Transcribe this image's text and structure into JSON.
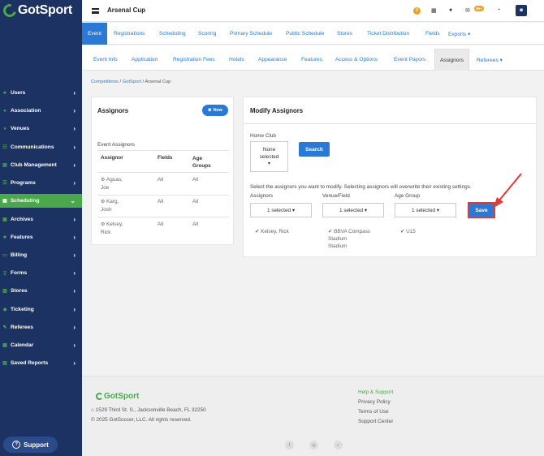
{
  "brand": {
    "name": "GotSport",
    "green": "#4aa84a",
    "navy": "#1c3263",
    "blue": "#2a7ad5",
    "highlight_red": "#e53935"
  },
  "topbar": {
    "title": "Arsenal Cup",
    "notification_count": "99+",
    "icons": [
      "menu-icon",
      "help-icon",
      "grid-icon",
      "user-icon",
      "mail-icon",
      "chat-icon",
      "account-icon"
    ]
  },
  "sidebar": {
    "items": [
      {
        "label": "Users",
        "icon": "users-icon"
      },
      {
        "label": "Association",
        "icon": "association-icon"
      },
      {
        "label": "Venues",
        "icon": "venues-icon"
      },
      {
        "label": "Communications",
        "icon": "communications-icon"
      },
      {
        "label": "Club Management",
        "icon": "club-icon"
      },
      {
        "label": "Programs",
        "icon": "programs-icon"
      },
      {
        "label": "Scheduling",
        "icon": "scheduling-icon",
        "active": true
      },
      {
        "label": "Archives",
        "icon": "archives-icon"
      },
      {
        "label": "Features",
        "icon": "features-icon"
      },
      {
        "label": "Billing",
        "icon": "billing-icon"
      },
      {
        "label": "Forms",
        "icon": "forms-icon"
      },
      {
        "label": "Stores",
        "icon": "stores-icon"
      },
      {
        "label": "Ticketing",
        "icon": "ticketing-icon"
      },
      {
        "label": "Referees",
        "icon": "referees-icon"
      },
      {
        "label": "Calendar",
        "icon": "calendar-icon"
      },
      {
        "label": "Saved Reports",
        "icon": "reports-icon"
      }
    ],
    "support_label": "Support"
  },
  "main_tabs": [
    "Event",
    "Registrations",
    "Scheduling",
    "Scoring",
    "Primary Schedule",
    "Public Schedule",
    "Stores",
    "Ticket Distribution",
    "Fields",
    "Exports ▾"
  ],
  "sub_tabs": [
    "Event Info",
    "Application",
    "Registration Fees",
    "Hotels",
    "Appearance",
    "Features",
    "Access & Options",
    "Event Payors",
    "Assignors",
    "Referees ▾"
  ],
  "breadcrumb": {
    "items": [
      "Competitions",
      "GotSport",
      "Arsenal Cup"
    ],
    "separator": "/"
  },
  "assignors_card": {
    "title": "Assignors",
    "new_button": "New",
    "section_label": "Event Assignors",
    "columns": [
      "Assignor",
      "Fields",
      "Age\nGroups"
    ],
    "rows": [
      {
        "name": "Aguas,\nJoe",
        "fields": "All",
        "age_groups": "All"
      },
      {
        "name": "Karg,\nJosh",
        "fields": "All",
        "age_groups": "All"
      },
      {
        "name": "Kelsey,\nRick",
        "fields": "All",
        "age_groups": "All"
      }
    ]
  },
  "modify_card": {
    "title": "Modify Assignors",
    "home_club_label": "Home Club",
    "home_club_value": "None\nselected",
    "search_button": "Search",
    "instruction": "Select the assignors you want to modify. Selecting assignors will overwrite their existing settings.",
    "filters": [
      {
        "label": "Assignors",
        "value": "1 selected ▾",
        "selected": [
          "Kelsey, Rick"
        ]
      },
      {
        "label": "Venue/Field",
        "value": "1 selected ▾",
        "selected": [
          "BBVA Compass\nStadium\n    Stadium"
        ]
      },
      {
        "label": "Age Group",
        "value": "1 selected ▾",
        "selected": [
          "U15"
        ]
      }
    ],
    "save_button": "Save"
  },
  "footer": {
    "brand": "GotSport",
    "address": "1529 Third St. S., Jacksonville Beach, FL 32250",
    "copyright": "© 2025 GotSoccer, LLC. All rights reserved.",
    "links": [
      "Help & Support",
      "Privacy Policy",
      "Terms of Use",
      "Support Center"
    ],
    "social": [
      "f",
      "◎",
      "✓"
    ]
  }
}
